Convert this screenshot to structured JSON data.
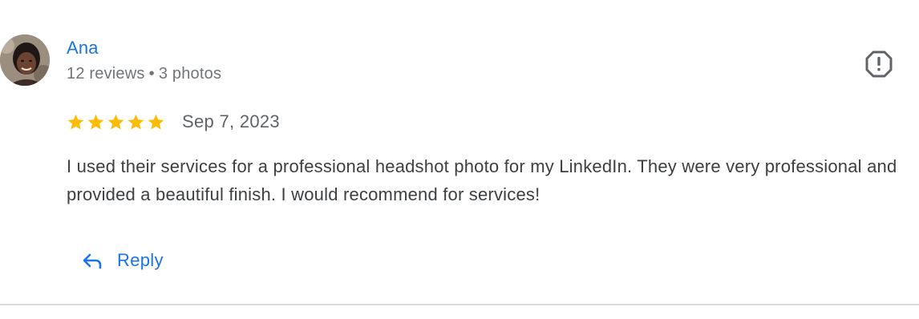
{
  "review": {
    "author": {
      "name": "Ana",
      "review_count": "12 reviews",
      "separator": "•",
      "photo_count": "3 photos",
      "avatar_icon": "user-avatar"
    },
    "rating": {
      "stars": 5,
      "max_stars": 5,
      "star_color": "#fbbc04"
    },
    "date": "Sep 7, 2023",
    "text": "I used their services for a professional headshot photo for my LinkedIn. They were very professional and provided a beautiful finish. I would recommend for services!",
    "actions": {
      "reply_label": "Reply",
      "reply_icon": "reply-arrow-icon",
      "flag_icon": "report-flag-icon"
    }
  },
  "colors": {
    "link_blue": "#1a73e8",
    "meta_gray": "#70757a",
    "body_text": "#3c4043",
    "divider": "#dadce0"
  }
}
